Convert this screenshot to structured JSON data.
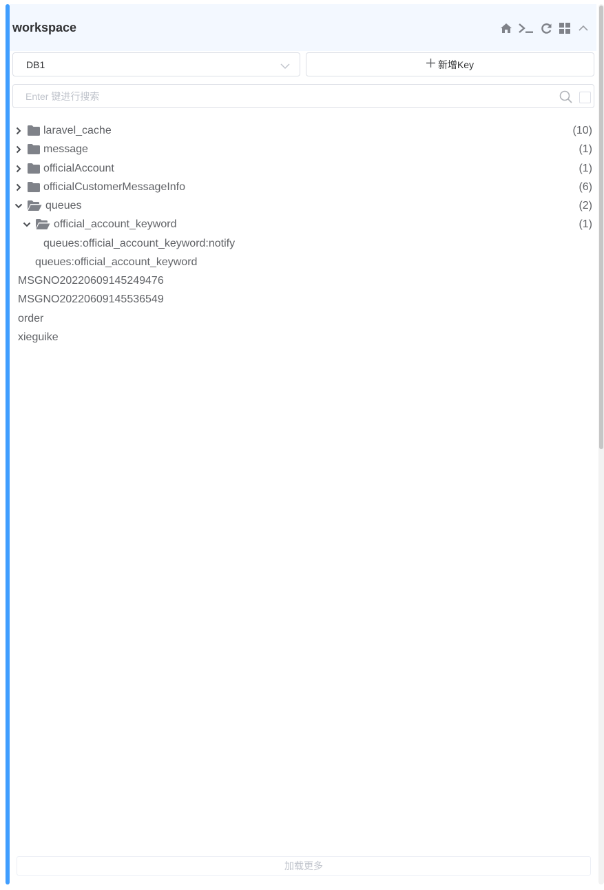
{
  "header": {
    "title": "workspace",
    "icons": [
      "home-icon",
      "terminal-icon",
      "refresh-icon",
      "grid-icon",
      "chevron-up-icon"
    ]
  },
  "toolbar": {
    "db_select_value": "DB1",
    "add_key_label": "新增Key",
    "search_placeholder": "Enter 键进行搜索"
  },
  "tree": {
    "nodes": [
      {
        "label": "laravel_cache",
        "count": "(10)",
        "type": "folder",
        "expanded": false,
        "level": 0
      },
      {
        "label": "message",
        "count": "(1)",
        "type": "folder",
        "expanded": false,
        "level": 0
      },
      {
        "label": "officialAccount",
        "count": "(1)",
        "type": "folder",
        "expanded": false,
        "level": 0
      },
      {
        "label": "officialCustomerMessageInfo",
        "count": "(6)",
        "type": "folder",
        "expanded": false,
        "level": 0
      },
      {
        "label": "queues",
        "count": "(2)",
        "type": "folder",
        "expanded": true,
        "level": 0
      },
      {
        "label": "official_account_keyword",
        "count": "(1)",
        "type": "folder",
        "expanded": true,
        "level": 1
      },
      {
        "label": "queues:official_account_keyword:notify",
        "type": "key",
        "level": 2
      },
      {
        "label": "queues:official_account_keyword",
        "type": "key",
        "level": 1
      },
      {
        "label": "MSGNO20220609145249476",
        "type": "key",
        "level": 0
      },
      {
        "label": "MSGNO20220609145536549",
        "type": "key",
        "level": 0
      },
      {
        "label": "order",
        "type": "key",
        "level": 0
      },
      {
        "label": "xieguike",
        "type": "key",
        "level": 0
      }
    ]
  },
  "footer": {
    "load_more_label": "加载更多"
  },
  "colors": {
    "accent": "#409eff",
    "header_bg": "#f3f8ff",
    "icon": "#7f8289"
  }
}
